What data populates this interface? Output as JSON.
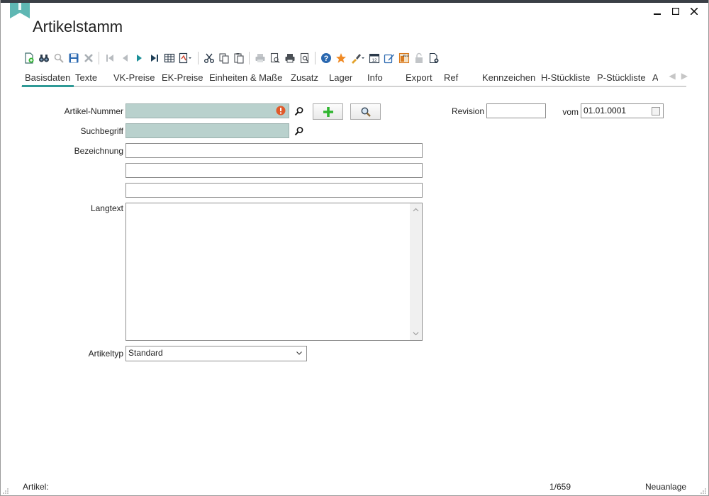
{
  "window": {
    "title": "Artikelstamm",
    "minimize": "—",
    "maximize": "☐",
    "close": "✕"
  },
  "toolbar": {
    "icons": [
      "new-icon",
      "binoculars-icon",
      "search-icon",
      "save-icon",
      "delete-icon",
      "first-record-icon",
      "previous-record-icon",
      "next-record-icon",
      "last-record-icon",
      "table-view-icon",
      "report-dropdown-icon",
      "cut-icon",
      "copy-icon",
      "paste-icon",
      "print-icon",
      "print-preview-icon",
      "print-setup-icon",
      "preview-icon",
      "help-icon",
      "favorite-icon",
      "brush-dropdown-icon",
      "calendar-icon",
      "edit-icon",
      "elo-icon",
      "lock-icon",
      "settings-document-icon"
    ],
    "accent": "#2f9a96"
  },
  "tabs": {
    "items": [
      {
        "label": "Basisdaten",
        "active": true
      },
      {
        "label": "Texte"
      },
      {
        "label": "VK-Preise"
      },
      {
        "label": "EK-Preise"
      },
      {
        "label": "Einheiten & Maße"
      },
      {
        "label": "Zusatz"
      },
      {
        "label": "Lager"
      },
      {
        "label": "Info"
      },
      {
        "label": "Export"
      },
      {
        "label": "Ref"
      },
      {
        "label": "Kennzeichen"
      },
      {
        "label": "H-Stückliste"
      },
      {
        "label": "P-Stückliste"
      },
      {
        "label": "A"
      }
    ],
    "prev": "◀",
    "next": "▶"
  },
  "form": {
    "artikel_nummer": {
      "label": "Artikel-Nummer",
      "value": ""
    },
    "suchbegriff": {
      "label": "Suchbegriff",
      "value": ""
    },
    "bezeichnung": {
      "label": "Bezeichnung",
      "line1": "",
      "line2": "",
      "line3": ""
    },
    "langtext": {
      "label": "Langtext",
      "value": ""
    },
    "artikeltyp": {
      "label": "Artikeltyp",
      "value": "Standard"
    },
    "revision": {
      "label": "Revision",
      "value": ""
    },
    "vom": {
      "label": "vom",
      "value": "01.01.0001"
    }
  },
  "status": {
    "left": "Artikel:",
    "record": "1/659",
    "mode": "Neuanlage"
  },
  "colors": {
    "required_field": "#b9d1cd",
    "error_badge": "#e05a2a",
    "add_green": "#2fb52f"
  }
}
